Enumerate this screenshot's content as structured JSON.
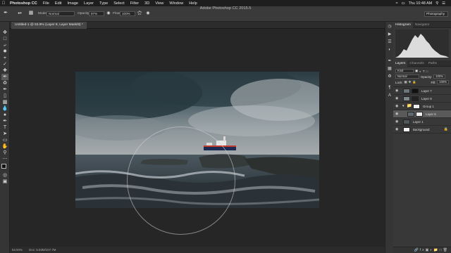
{
  "menubar": {
    "app": "Photoshop CC",
    "items": [
      "File",
      "Edit",
      "Image",
      "Layer",
      "Type",
      "Select",
      "Filter",
      "3D",
      "View",
      "Window",
      "Help"
    ],
    "clock": "Thu 10:48 AM"
  },
  "window_title": "Adobe Photoshop CC 2015.5",
  "options": {
    "mode_label": "Mode:",
    "mode_value": "Normal",
    "opacity_label": "Opacity:",
    "opacity_value": "97%",
    "flow_label": "Flow:",
    "flow_value": "100%",
    "workspace": "Photography"
  },
  "document_tab": "Untitled-1 @ 53.9% (Layer 8, Layer Mask/8) *",
  "status": {
    "zoom": "53.94%",
    "doc": "Doc: 5.93M/107.7M"
  },
  "panels": {
    "histogram_tabs": [
      "Histogram",
      "Navigator"
    ],
    "layer_tabs": [
      "Layers",
      "Channels",
      "Paths"
    ],
    "kind_label": "Kind",
    "blend_mode": "Normal",
    "opacity_label": "Opacity:",
    "opacity_value": "100%",
    "lock_label": "Lock:",
    "fill_label": "Fill:",
    "fill_value": "100%",
    "layers": [
      {
        "name": "Layer 7",
        "selected": false,
        "mask": true,
        "locked": false,
        "indent": false
      },
      {
        "name": "Layer 8",
        "selected": false,
        "mask": true,
        "locked": false,
        "indent": false
      },
      {
        "name": "Group 1",
        "selected": false,
        "mask": true,
        "locked": false,
        "indent": false
      },
      {
        "name": "Layer 6",
        "selected": true,
        "mask": true,
        "locked": false,
        "indent": true
      },
      {
        "name": "Layer 1",
        "selected": false,
        "mask": false,
        "locked": false,
        "indent": false
      },
      {
        "name": "Background",
        "selected": false,
        "mask": false,
        "locked": true,
        "indent": false
      }
    ],
    "footer_icons": [
      "link-icon",
      "fx-icon",
      "mask-icon",
      "adjustment-icon",
      "folder-icon",
      "new-layer-icon",
      "trash-icon"
    ]
  },
  "colors": {
    "ui_dark": "#1b1b1b",
    "panel": "#383838",
    "selected_layer": "#5a5a5a"
  }
}
